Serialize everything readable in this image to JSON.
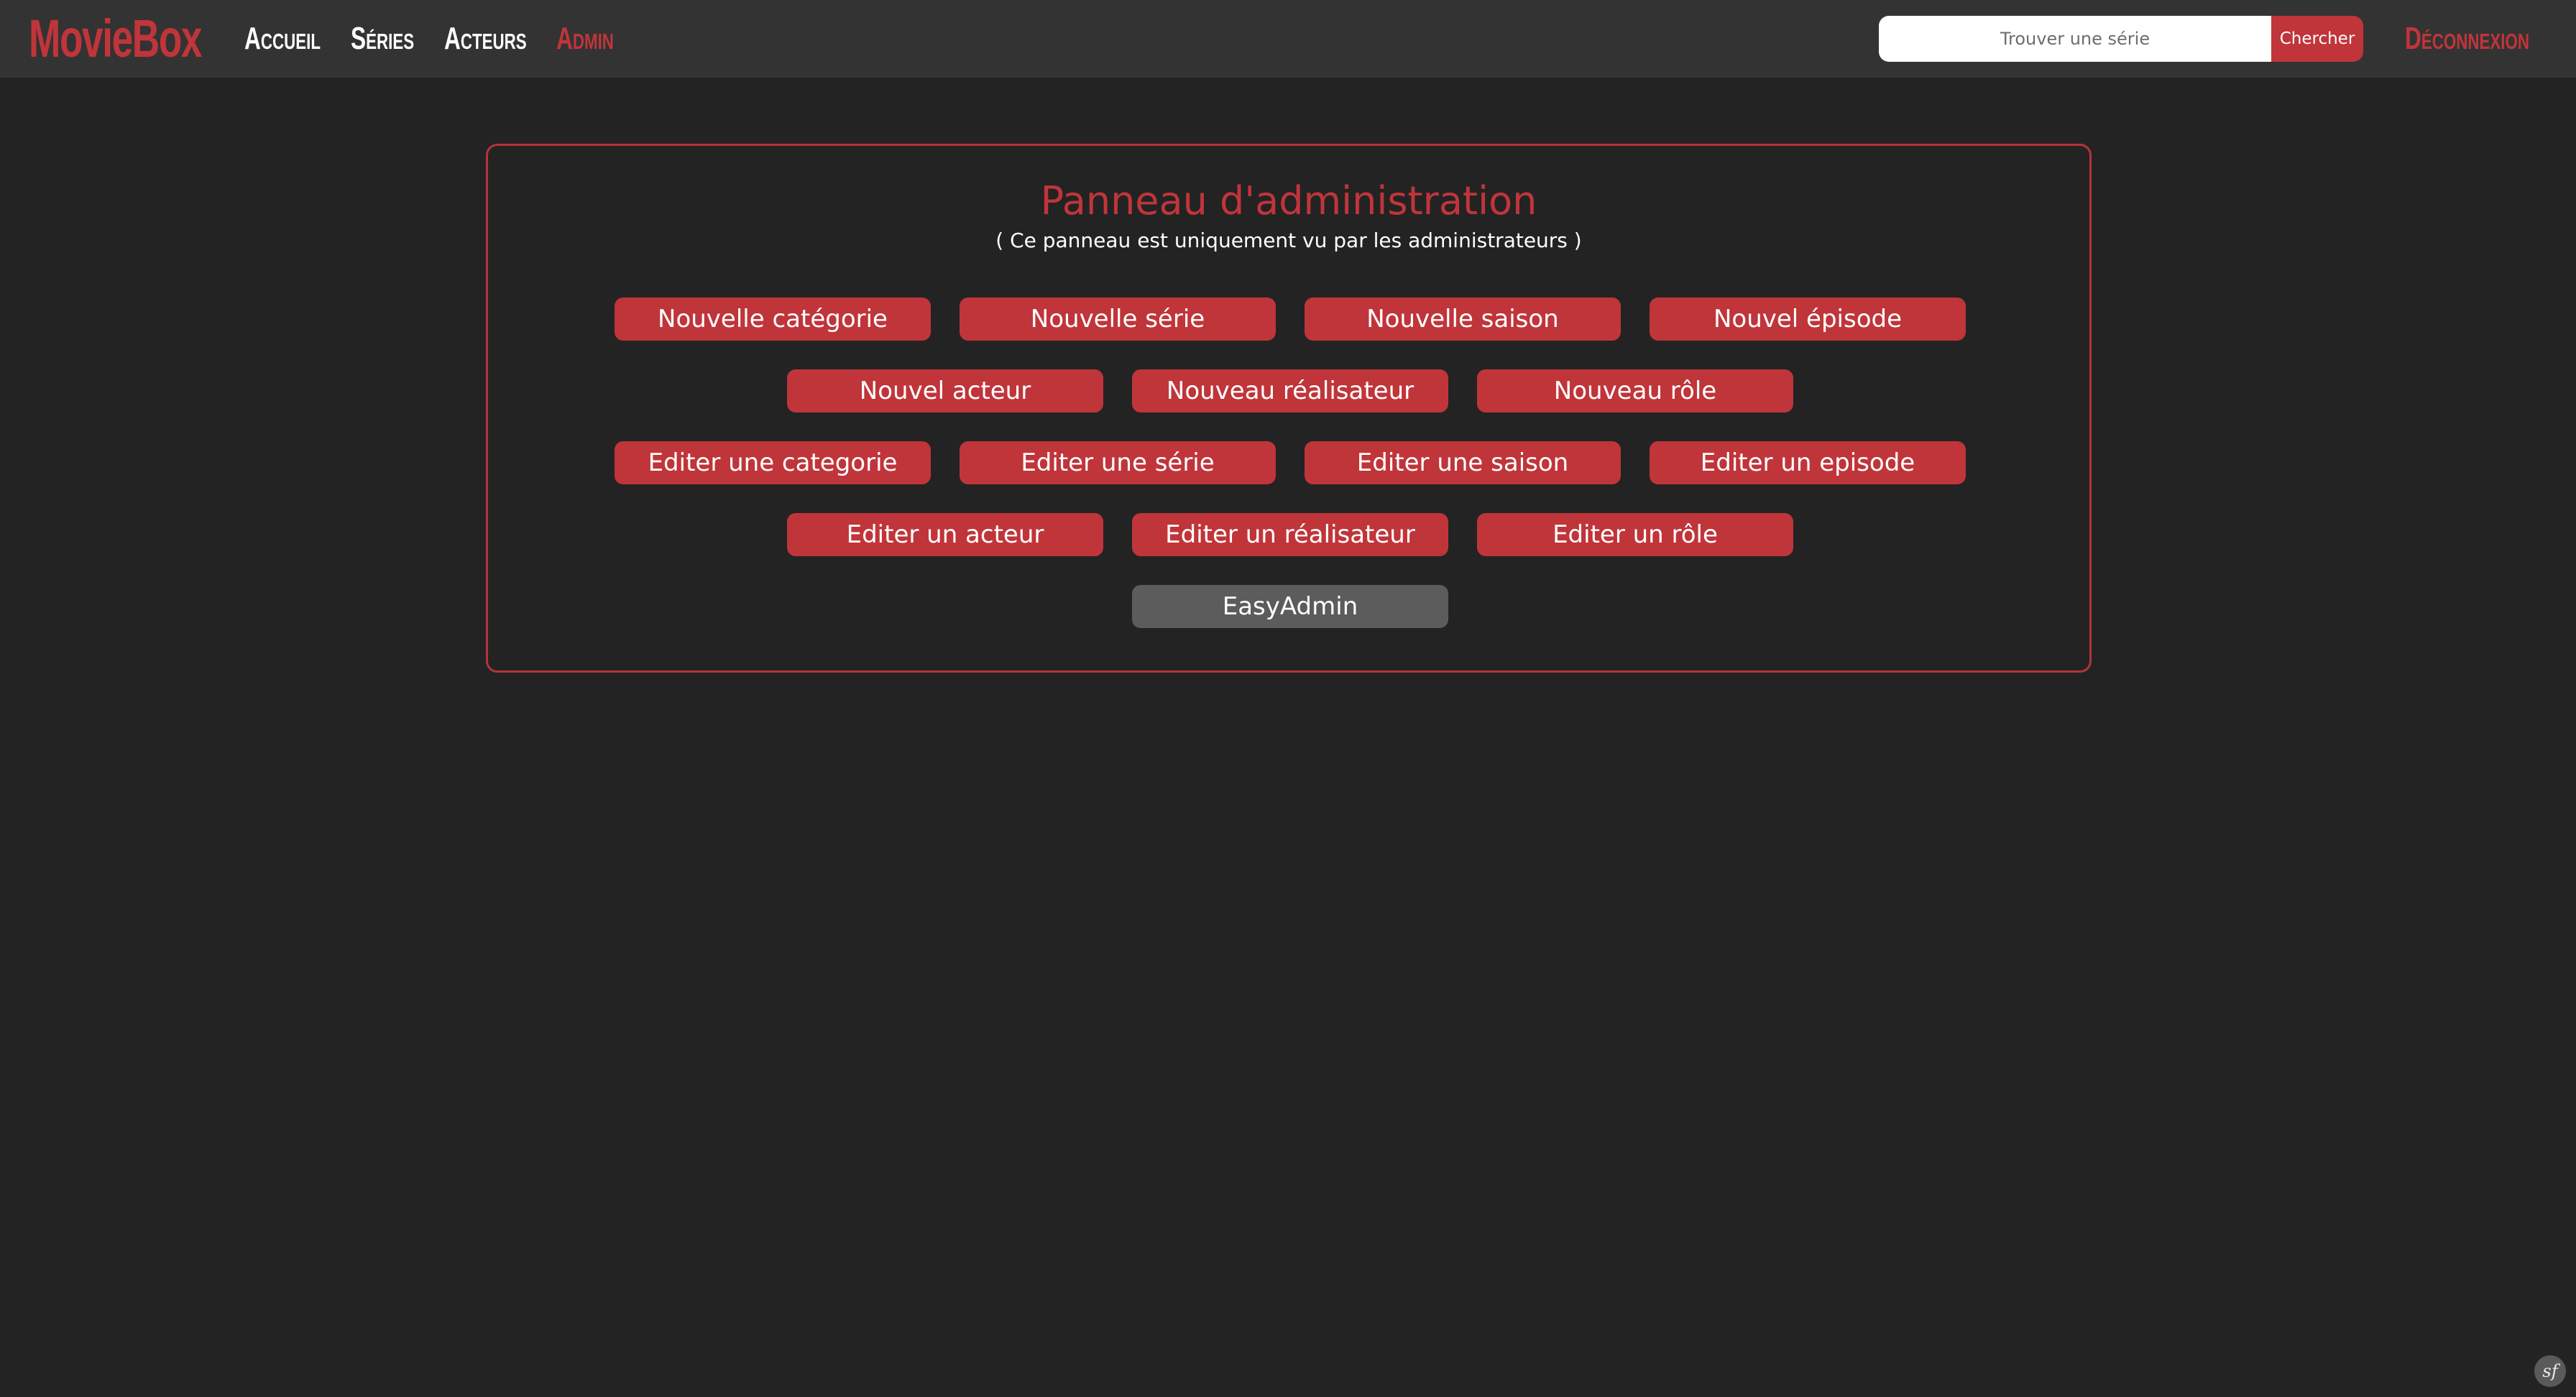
{
  "navbar": {
    "brand": "MovieBox",
    "links": [
      {
        "label": "Accueil"
      },
      {
        "label": "Séries"
      },
      {
        "label": "Acteurs"
      },
      {
        "label": "Admin"
      }
    ],
    "search": {
      "placeholder": "Trouver une série",
      "value": "",
      "button_label": "Chercher"
    },
    "logout_label": "Déconnexion"
  },
  "panel": {
    "title": "Panneau d'administration",
    "subtitle": "( Ce panneau est uniquement vu par les administrateurs )",
    "rows": [
      [
        "Nouvelle catégorie",
        "Nouvelle série",
        "Nouvelle saison",
        "Nouvel épisode"
      ],
      [
        "Nouvel acteur",
        "Nouveau réalisateur",
        "Nouveau rôle"
      ],
      [
        "Editer une categorie",
        "Editer une série",
        "Editer une saison",
        "Editer un episode"
      ],
      [
        "Editer un acteur",
        "Editer un réalisateur",
        "Editer un rôle"
      ],
      [
        "EasyAdmin"
      ]
    ]
  },
  "colors": {
    "accent": "#c0353a",
    "background": "#232323",
    "navbar": "#333333",
    "secondary_button": "#5c5c5c"
  },
  "toolbar": {
    "icon": "symfony-icon",
    "glyph": "sf"
  }
}
